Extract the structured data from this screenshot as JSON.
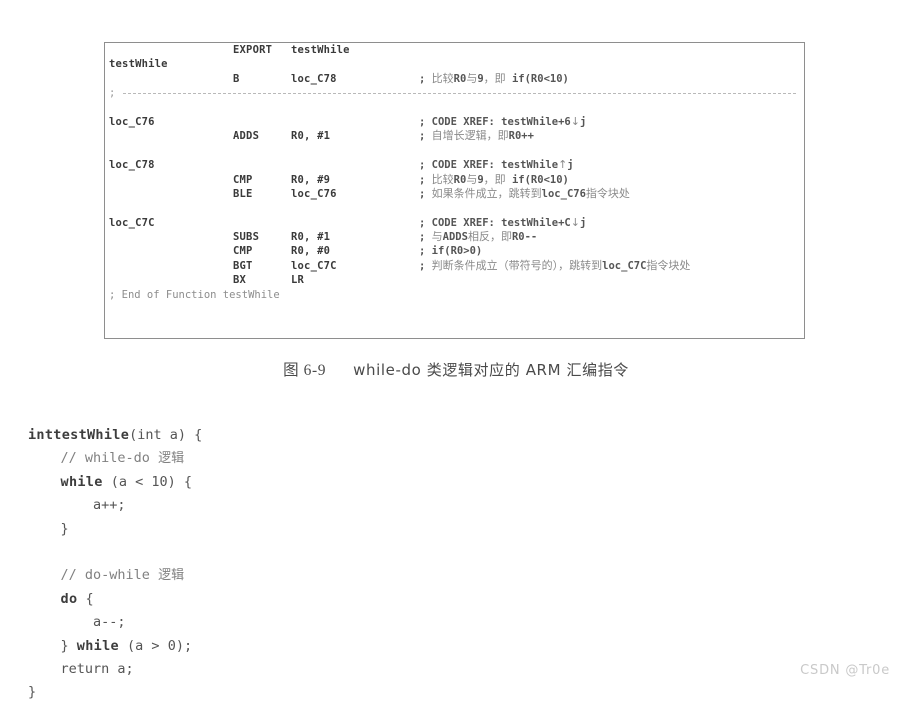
{
  "figure": {
    "caption_prefix": "图 6-9",
    "caption_text": "while-do 类逻辑对应的 ARM 汇编指令",
    "listing": {
      "lines": [
        {
          "type": "code",
          "label": "",
          "mnemonic": "EXPORT",
          "operands": "testWhile",
          "comment": ""
        },
        {
          "type": "code",
          "label": "testWhile",
          "mnemonic": "",
          "operands": "",
          "comment": ""
        },
        {
          "type": "code",
          "label": "",
          "mnemonic": "B",
          "operands": "loc_C78",
          "comment": "; 比较R0与9，即 if(R0<10)"
        },
        {
          "type": "separator",
          "text": ";"
        },
        {
          "type": "spacer"
        },
        {
          "type": "code",
          "label": "loc_C76",
          "mnemonic": "",
          "operands": "",
          "comment": "; CODE XREF: testWhile+6↓j"
        },
        {
          "type": "code",
          "label": "",
          "mnemonic": "ADDS",
          "operands": "R0, #1",
          "comment": "; 自增长逻辑，即R0++"
        },
        {
          "type": "spacer"
        },
        {
          "type": "code",
          "label": "loc_C78",
          "mnemonic": "",
          "operands": "",
          "comment": "; CODE XREF: testWhile↑j"
        },
        {
          "type": "code",
          "label": "",
          "mnemonic": "CMP",
          "operands": "R0, #9",
          "comment": "; 比较R0与9，即 if(R0<10)"
        },
        {
          "type": "code",
          "label": "",
          "mnemonic": "BLE",
          "operands": "loc_C76",
          "comment": "; 如果条件成立，跳转到loc_C76指令块处"
        },
        {
          "type": "spacer"
        },
        {
          "type": "code",
          "label": "loc_C7C",
          "mnemonic": "",
          "operands": "",
          "comment": "; CODE XREF: testWhile+C↓j"
        },
        {
          "type": "code",
          "label": "",
          "mnemonic": "SUBS",
          "operands": "R0, #1",
          "comment": "; 与ADDS相反，即R0--"
        },
        {
          "type": "code",
          "label": "",
          "mnemonic": "CMP",
          "operands": "R0, #0",
          "comment": "; if(R0>0)"
        },
        {
          "type": "code",
          "label": "",
          "mnemonic": "BGT",
          "operands": "loc_C7C",
          "comment": "; 判断条件成立（带符号的），跳转到loc_C7C指令块处"
        },
        {
          "type": "code",
          "label": "",
          "mnemonic": "BX",
          "operands": "LR",
          "comment": ""
        },
        {
          "type": "end",
          "text": "; End of Function testWhile"
        }
      ]
    }
  },
  "c_code": {
    "lines": [
      "inttestWhile(int a) {",
      "    // while-do 逻辑",
      "    while (a < 10) {",
      "        a++;",
      "    }",
      "",
      "    // do-while 逻辑",
      "    do {",
      "        a--;",
      "    } while (a > 0);",
      "    return a;",
      "}"
    ]
  },
  "watermark": {
    "text": "CSDN @Tr0e"
  },
  "colors": {
    "page_background": "#ffffff",
    "box_border": "#8e8e8e",
    "code_text": "#5f5f5f",
    "comment_text": "#8a8a8a",
    "watermark": "#c9c9c9"
  }
}
